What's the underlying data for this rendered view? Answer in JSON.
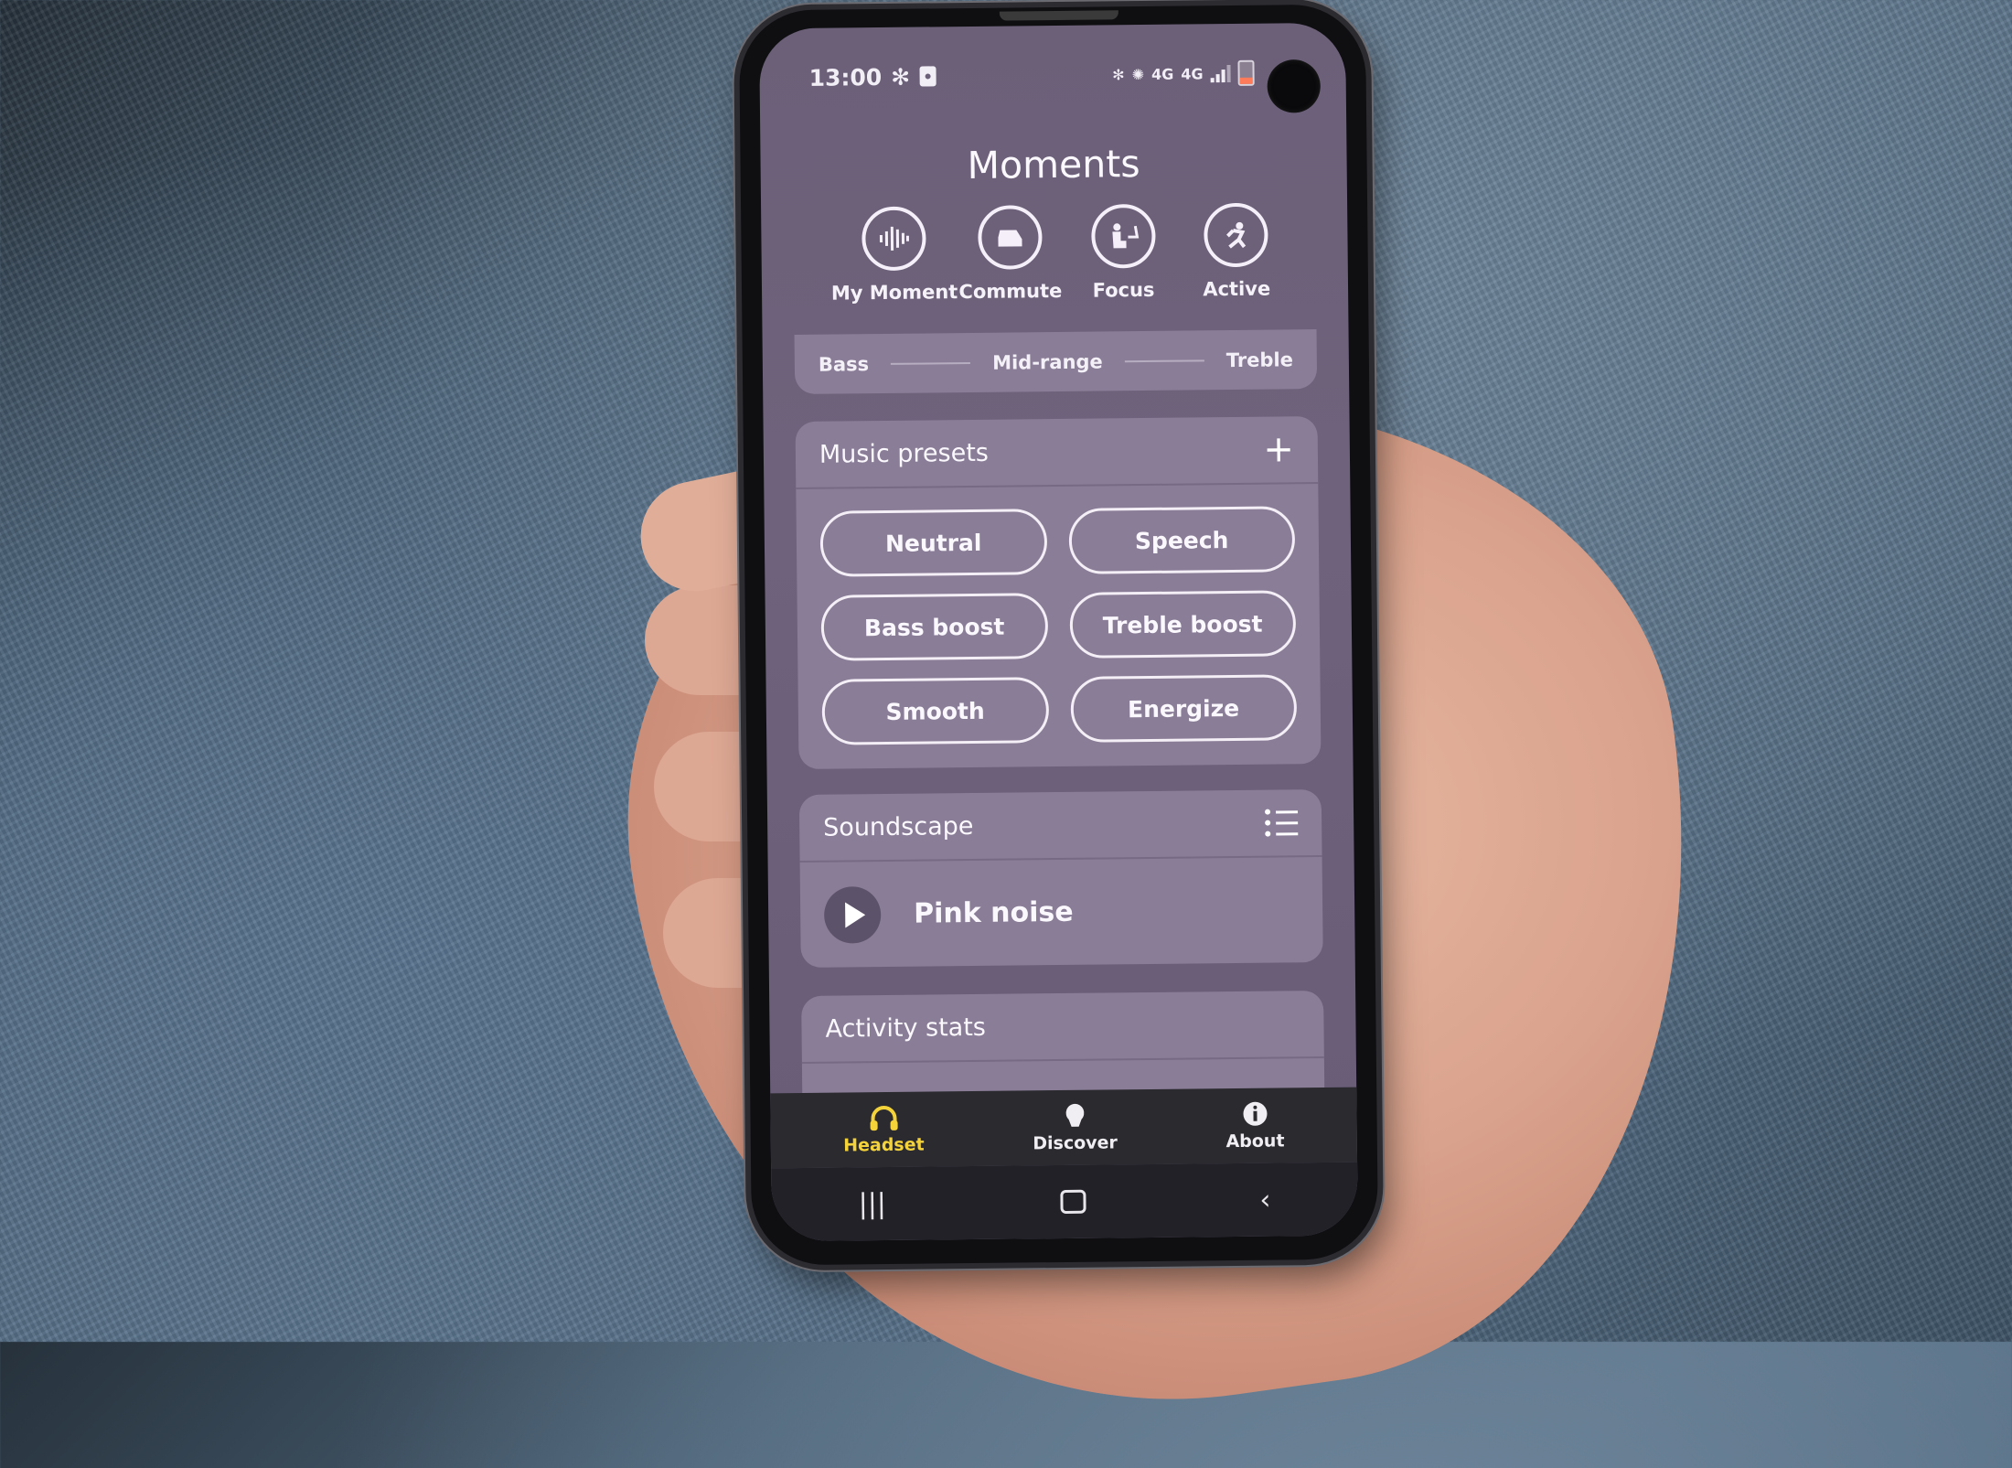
{
  "status_bar": {
    "time": "13:00",
    "network_labels": [
      "4G",
      "4G"
    ]
  },
  "header": {
    "title": "Moments"
  },
  "moments": [
    {
      "label": "My Moment",
      "icon": "soundwave-icon",
      "glyph": "|||"
    },
    {
      "label": "Commute",
      "icon": "car-seat-icon",
      "glyph": "🚗"
    },
    {
      "label": "Focus",
      "icon": "desk-person-icon",
      "glyph": "✎"
    },
    {
      "label": "Active",
      "icon": "runner-icon",
      "glyph": "🏃"
    }
  ],
  "equalizer": {
    "labels": [
      "Bass",
      "Mid-range",
      "Treble"
    ]
  },
  "music_presets": {
    "title": "Music presets",
    "add_label": "+",
    "items": [
      "Neutral",
      "Speech",
      "Bass boost",
      "Treble boost",
      "Smooth",
      "Energize"
    ]
  },
  "soundscape": {
    "title": "Soundscape",
    "current": "Pink noise"
  },
  "activity_stats": {
    "title": "Activity stats"
  },
  "tabbar": {
    "items": [
      {
        "label": "Headset",
        "icon": "headset-icon",
        "glyph": "🎧",
        "active": true
      },
      {
        "label": "Discover",
        "icon": "lightbulb-icon",
        "glyph": "💡",
        "active": false
      },
      {
        "label": "About",
        "icon": "info-icon",
        "glyph": "ⓘ",
        "active": false
      }
    ]
  },
  "navbar": {
    "recents": "|||",
    "back": "‹"
  },
  "colors": {
    "accent_active_tab": "#f4d33a",
    "card_bg": "#8a7d97",
    "screen_bg": "#6c6079"
  }
}
